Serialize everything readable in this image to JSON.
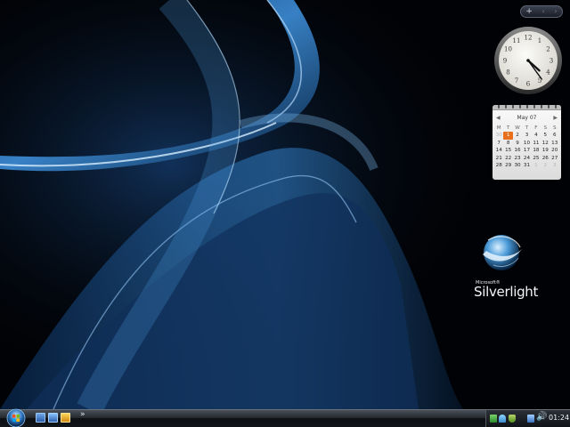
{
  "desktop": {
    "colors": {
      "background": "#010205",
      "ribbon_light": "#cfe9ff",
      "ribbon_mid": "#3b8fd6",
      "ribbon_dark": "#0b2f63"
    }
  },
  "sidebar": {
    "controls": {
      "add": "+",
      "prev": "‹",
      "next": "›"
    }
  },
  "clock": {
    "hour": 4,
    "minute": 24
  },
  "calendar": {
    "month_label": "May 07",
    "weekdays": [
      "M",
      "T",
      "W",
      "T",
      "F",
      "S",
      "S"
    ],
    "weeks": [
      [
        "30",
        "1",
        "2",
        "3",
        "4",
        "5",
        "6"
      ],
      [
        "7",
        "8",
        "9",
        "10",
        "11",
        "12",
        "13"
      ],
      [
        "14",
        "15",
        "16",
        "17",
        "18",
        "19",
        "20"
      ],
      [
        "21",
        "22",
        "23",
        "24",
        "25",
        "26",
        "27"
      ],
      [
        "28",
        "29",
        "30",
        "31",
        "1",
        "2",
        "3"
      ]
    ],
    "today": "1",
    "accent_color": "#e8701c"
  },
  "silverlight": {
    "small_text": "Microsoft®",
    "brand": "Silverlight"
  },
  "taskbar": {
    "quick_launch_chevron": "»",
    "tray_volume_glyph": "🔊",
    "time": "01:24",
    "icons": [
      "windows-orb-icon",
      "show-desktop-icon",
      "switch-windows-icon",
      "media-player-icon",
      "network-icon",
      "user-icon",
      "shield-icon",
      "display-icon",
      "volume-icon"
    ]
  }
}
